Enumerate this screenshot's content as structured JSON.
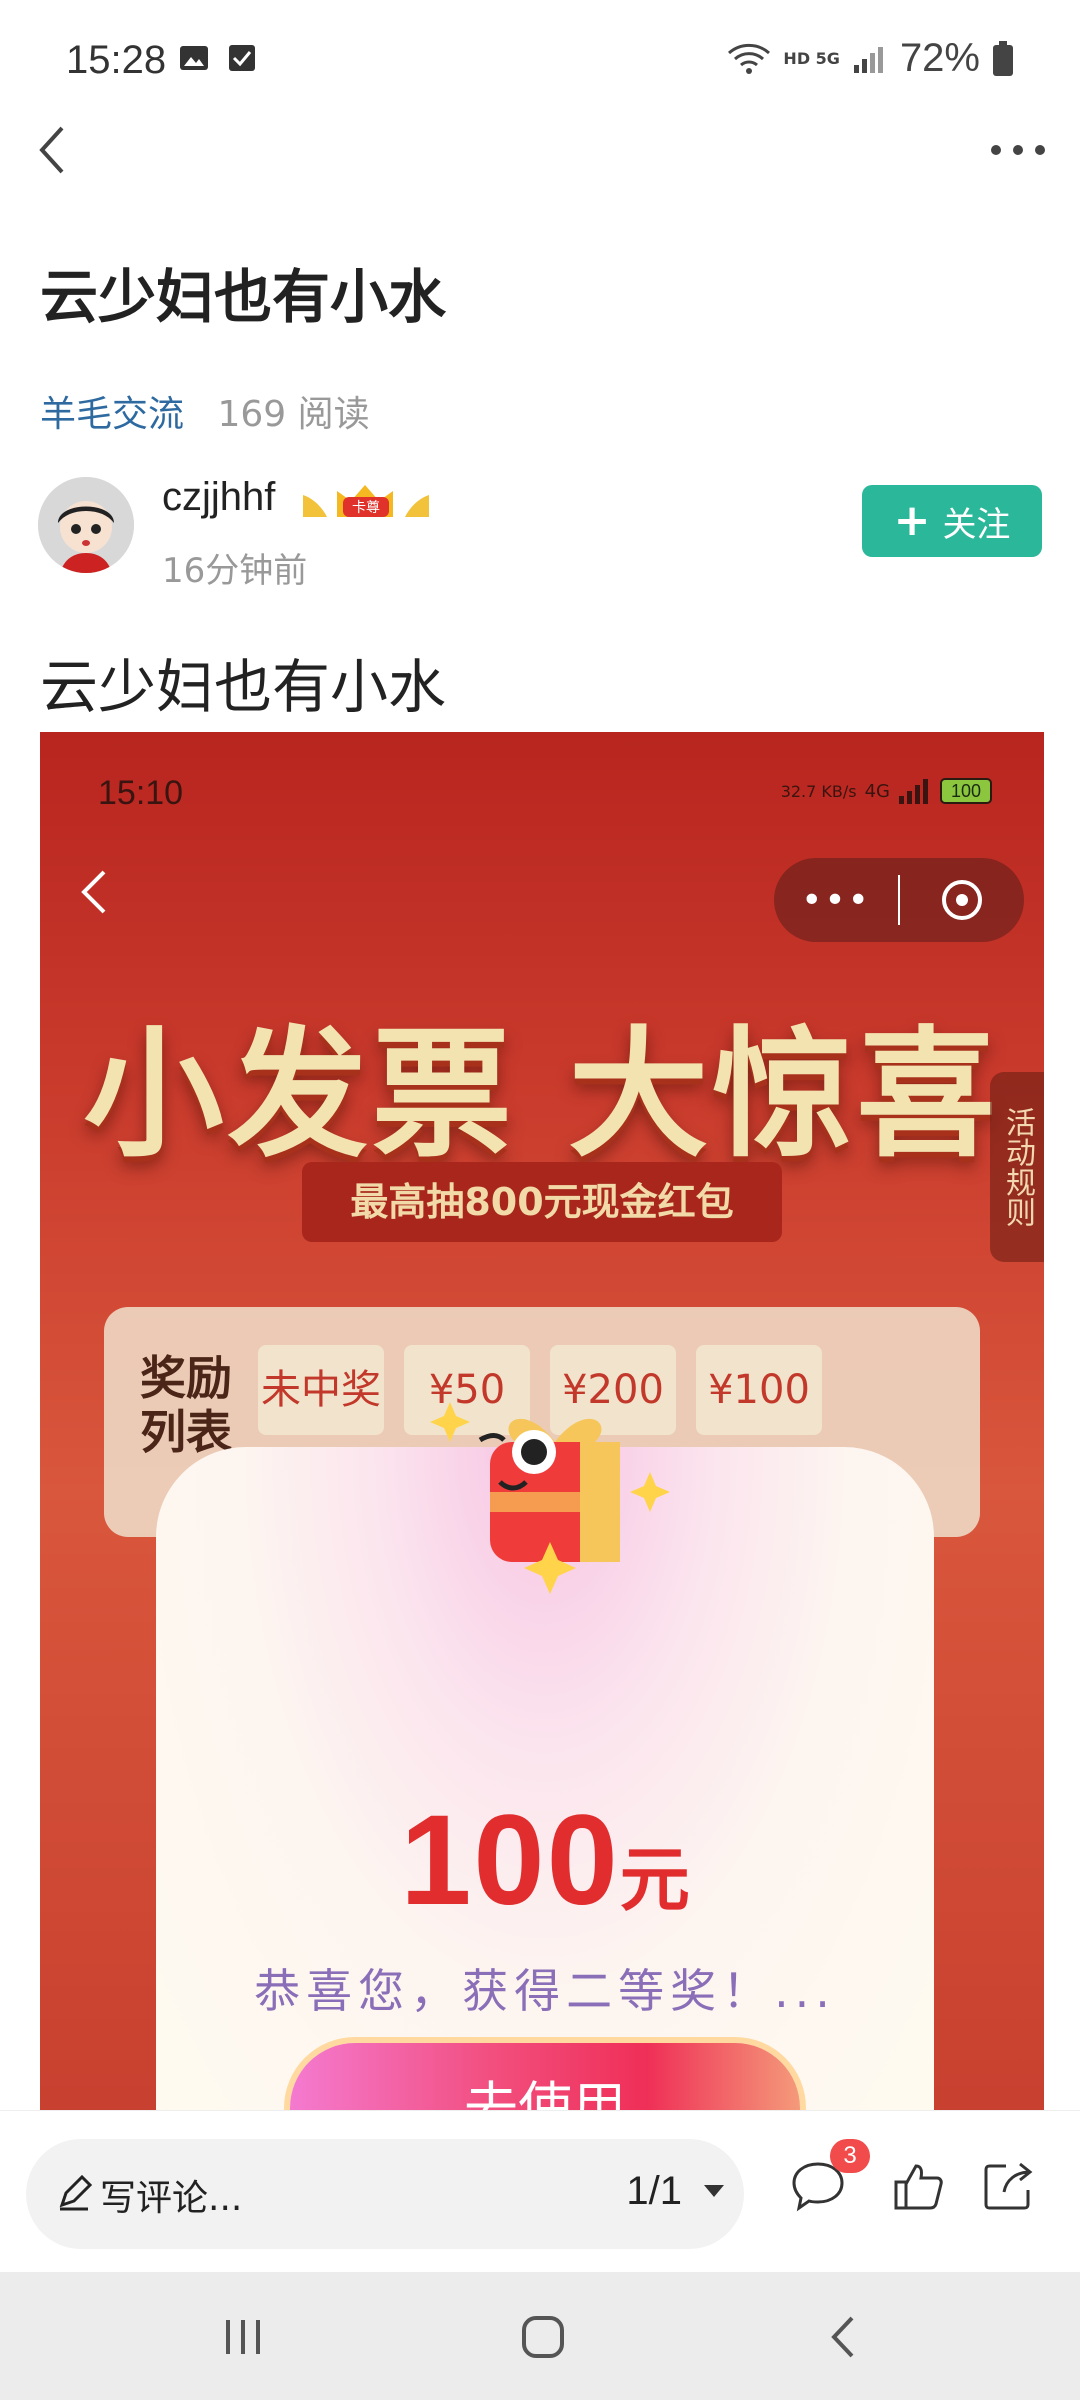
{
  "status_bar": {
    "time": "15:28",
    "network": "HD 5G",
    "battery": "72%"
  },
  "post": {
    "title": "云少妇也有小水",
    "category": "羊毛交流",
    "reads": "169 阅读",
    "author": {
      "name": "czjjhhf",
      "badge_text": "卡尊",
      "posted": "16分钟前"
    },
    "follow_label": "关注",
    "body_text": "云少妇也有小水"
  },
  "embedded": {
    "time": "15:10",
    "speed": "32.7 KB/s",
    "net": "4G",
    "battery": "100",
    "headline": "小发票 大惊喜",
    "subheadline": "最高抽800元现金红包",
    "rules": "活动规则",
    "reward_title": "奖励列表",
    "reward_tiles": [
      "未中奖",
      "¥50",
      "¥200",
      "¥100"
    ],
    "amount_value": "100",
    "amount_unit": "元",
    "congrats": "恭喜您，获得二等奖！...",
    "use_button": "去使用"
  },
  "bottom": {
    "comment_placeholder": "写评论...",
    "page": "1/1",
    "comment_count": "3"
  },
  "colors": {
    "accent": "#2bb79a",
    "link": "#2e6aa0",
    "badge": "#f24b4b"
  }
}
